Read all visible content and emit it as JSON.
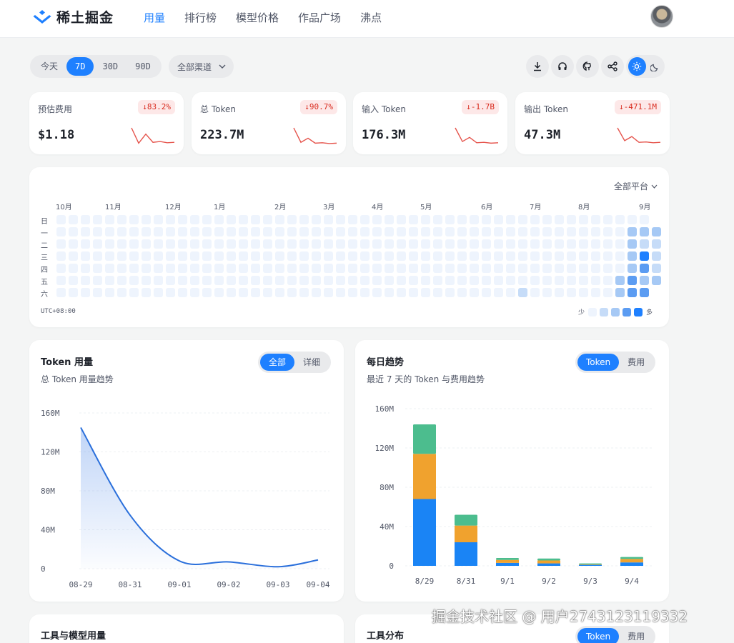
{
  "header": {
    "logo_text": "稀土掘金",
    "nav": [
      "用量",
      "排行榜",
      "模型价格",
      "作品广场",
      "沸点"
    ]
  },
  "toolbar": {
    "ranges": [
      "今天",
      "7D",
      "30D",
      "90D"
    ],
    "active_range": "7D",
    "channel": "全部渠道",
    "icons": [
      "download-icon",
      "headset-icon",
      "github-icon",
      "share-icon",
      "sun-icon",
      "moon-icon"
    ]
  },
  "stats": [
    {
      "label": "预估费用",
      "badge": "↓83.2%",
      "value": "$1.18",
      "spark": [
        45,
        8,
        30,
        10,
        12,
        9,
        10
      ]
    },
    {
      "label": "总 Token",
      "badge": "↓90.7%",
      "value": "223.7M",
      "spark": [
        45,
        10,
        20,
        8,
        9,
        7,
        8
      ]
    },
    {
      "label": "输入 Token",
      "badge": "↓-1.7B",
      "value": "176.3M",
      "spark": [
        45,
        12,
        22,
        9,
        10,
        8,
        9
      ]
    },
    {
      "label": "输出 Token",
      "badge": "↓-471.1M",
      "value": "47.3M",
      "spark": [
        45,
        14,
        24,
        10,
        11,
        9,
        10
      ]
    }
  ],
  "heatmap": {
    "platform": "全部平台",
    "months": [
      "10月",
      "11月",
      "12月",
      "1月",
      "2月",
      "3月",
      "4月",
      "5月",
      "6月",
      "7月",
      "8月",
      "9月"
    ],
    "weekdays": [
      "日",
      "一",
      "二",
      "三",
      "四",
      "五",
      "六"
    ],
    "timezone": "UTC+08:00",
    "legend_less": "少",
    "legend_more": "多",
    "colors": [
      "#eef4fd",
      "#c6dcf8",
      "#a6c9f5",
      "#5b9cf2",
      "#1e80ff"
    ]
  },
  "token_usage": {
    "title": "Token 用量",
    "subtitle": "总 Token 用量趋势",
    "toggle": [
      "全部",
      "详细"
    ],
    "active": "全部"
  },
  "daily_trend": {
    "title": "每日趋势",
    "subtitle": "最近 7 天的 Token 与费用趋势",
    "toggle": [
      "Token",
      "费用"
    ],
    "active": "Token"
  },
  "bottom": {
    "left_title": "工具与模型用量",
    "right_title": "工具分布",
    "toggle": [
      "Token",
      "费用"
    ]
  },
  "watermark": "掘金技术社区 @ 用户2743123119332",
  "chart_data": [
    {
      "type": "area",
      "title": "Token 用量",
      "x": [
        "08-29",
        "08-31",
        "09-01",
        "09-02",
        "09-03",
        "09-04"
      ],
      "values": [
        145,
        55,
        8,
        7,
        2,
        9
      ],
      "yticks": [
        "0",
        "40M",
        "80M",
        "120M",
        "160M"
      ],
      "ylim": [
        0,
        160
      ],
      "color": "#2a6fdb"
    },
    {
      "type": "bar",
      "title": "每日趋势",
      "categories": [
        "8/29",
        "8/31",
        "9/1",
        "9/2",
        "9/3",
        "9/4"
      ],
      "series": [
        {
          "values": [
            68,
            24,
            3,
            2.5,
            1,
            3.5
          ],
          "color": "#1a84f5"
        },
        {
          "values": [
            46,
            17,
            3,
            3,
            0.5,
            3.5
          ],
          "color": "#f0a22e"
        },
        {
          "values": [
            30,
            11,
            2,
            2,
            1,
            2
          ],
          "color": "#4cbd8e"
        }
      ],
      "yticks": [
        "0",
        "40M",
        "80M",
        "120M",
        "160M"
      ],
      "ylim": [
        0,
        160
      ]
    }
  ]
}
